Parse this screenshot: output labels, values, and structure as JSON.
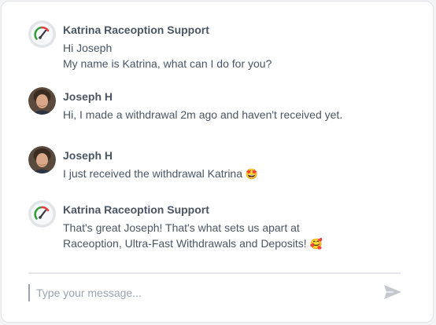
{
  "chat": {
    "messages": [
      {
        "sender": "Katrina Raceoption Support",
        "avatar": "support-gauge-logo",
        "lines": [
          "Hi Joseph",
          "My name is Katrina, what can I do for you?"
        ]
      },
      {
        "sender": "Joseph H",
        "avatar": "user-photo",
        "lines": [
          "Hi, I made a withdrawal 2m ago and haven't received yet."
        ]
      },
      {
        "sender": "Joseph H",
        "avatar": "user-photo",
        "lines": [
          "I just received the withdrawal Katrina"
        ],
        "emoji": "🤩"
      },
      {
        "sender": "Katrina Raceoption Support",
        "avatar": "support-gauge-logo",
        "lines": [
          "That's great Joseph! That's what sets us apart at",
          "Raceoption, Ultra-Fast Withdrawals and Deposits!"
        ],
        "emoji": "🥰"
      }
    ]
  },
  "composer": {
    "placeholder": "Type your message...",
    "value": ""
  },
  "icons": {
    "send": "send-icon"
  },
  "colors": {
    "text": "#4b5563",
    "placeholder": "#9ca3af",
    "gauge_green": "#2f9e3a",
    "gauge_red": "#e04040",
    "send_icon": "#c4c8ce"
  }
}
